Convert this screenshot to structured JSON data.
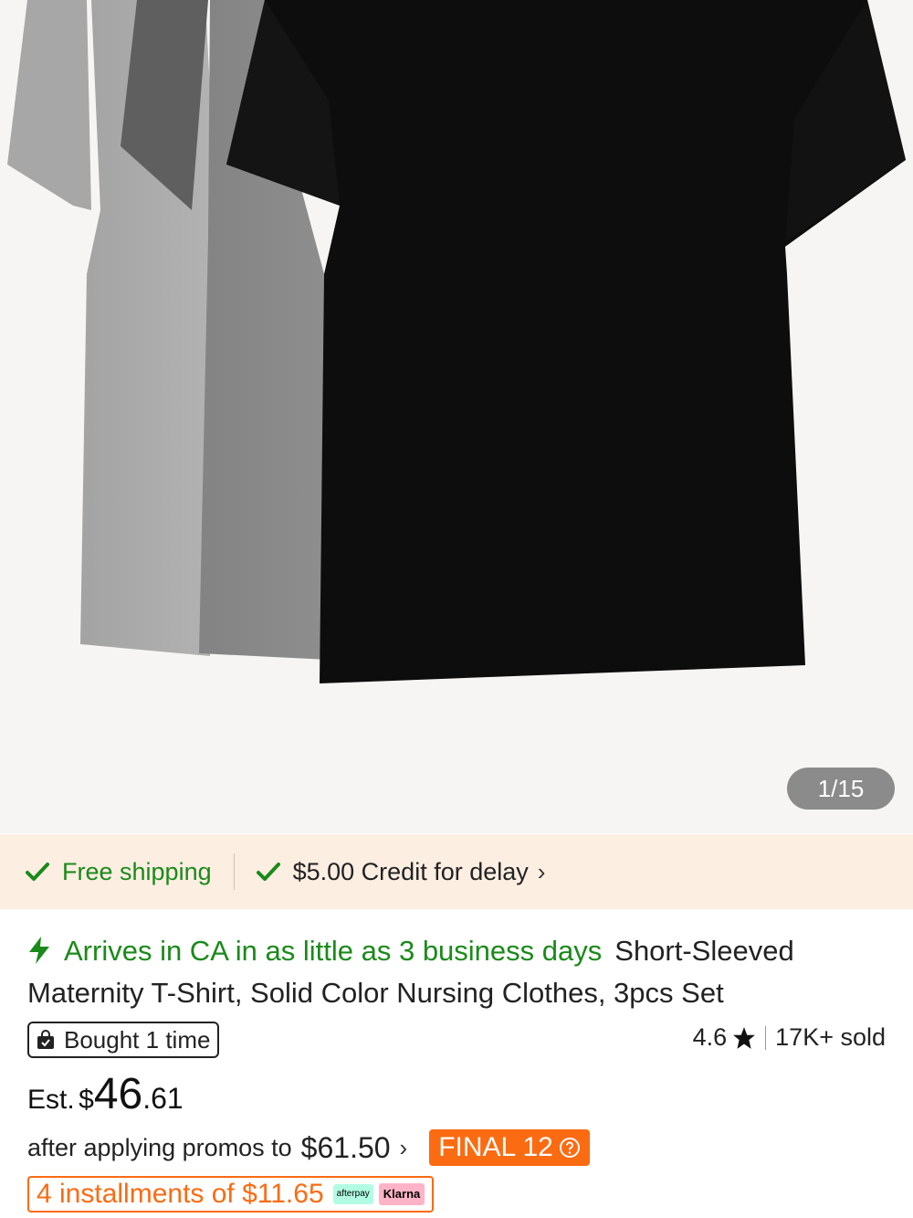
{
  "gallery": {
    "counter": "1/15",
    "image_alt": "grey and black short-sleeved t-shirts"
  },
  "shipping": {
    "free": "Free shipping",
    "credit": "$5.00 Credit for delay"
  },
  "product": {
    "arrival": "Arrives in CA in as little as 3 business days",
    "title": "Short-Sleeved Maternity T-Shirt, Solid Color Nursing Clothes, 3pcs Set",
    "bought": "Bought 1 time",
    "rating": "4.6",
    "sold": "17K+ sold"
  },
  "price": {
    "est_label": "Est.",
    "currency": "$",
    "whole": "46",
    "cents": ".61",
    "promo_text": "after applying promos to",
    "promo_amount": "$61.50",
    "final_badge": "FINAL 12",
    "installments": "4 installments of $11.65",
    "afterpay": "afterpay",
    "klarna": "Klarna"
  },
  "colors": {
    "green": "#1a8a1a",
    "orange": "#fb6b12",
    "ship_bg": "#fdeee2"
  },
  "icons": {
    "check": "check-icon",
    "bolt": "lightning-icon",
    "bag": "shopping-bag-icon",
    "star": "star-icon",
    "chevron": "chevron-right-icon",
    "help": "question-circle-icon"
  }
}
